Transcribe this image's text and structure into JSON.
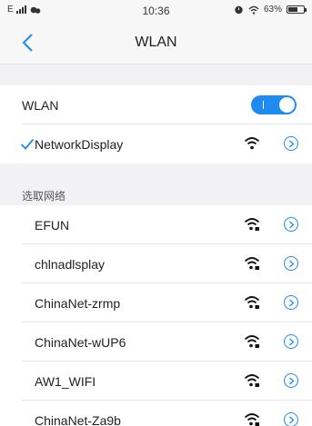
{
  "status_bar": {
    "network": "E",
    "time": "10:36",
    "battery": "63%",
    "battery_level": 0.63
  },
  "nav": {
    "back_icon": "chevron-left-icon",
    "title": "WLAN"
  },
  "wlan_toggle": {
    "label": "WLAN",
    "state": "on"
  },
  "connected": {
    "name": "NetworkDisplay"
  },
  "networks_section": {
    "title": "选取网络",
    "items": [
      {
        "name": "EFUN"
      },
      {
        "name": "chlnadlsplay"
      },
      {
        "name": "ChinaNet-zrmp"
      },
      {
        "name": "ChinaNet-wUP6"
      },
      {
        "name": "AW1_WIFI"
      },
      {
        "name": "ChinaNet-Za9b"
      }
    ]
  },
  "colors": {
    "accent": "#1e8bf2",
    "background": "#f2f2f4"
  }
}
